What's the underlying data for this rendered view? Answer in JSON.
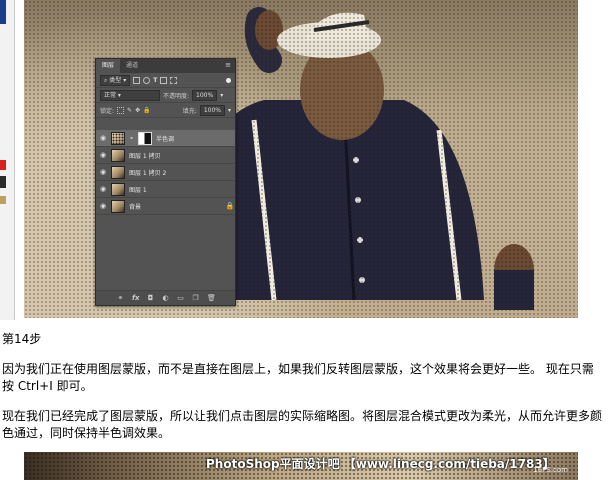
{
  "ps_panel": {
    "tab_layers": "图层",
    "tab_channels": "通道",
    "filter_kind": "类型",
    "blend_mode": "正常",
    "opacity_label": "不透明度:",
    "opacity_value": "100%",
    "lock_label": "锁定:",
    "fill_label": "填充:",
    "fill_value": "100%",
    "layers": [
      {
        "name": "半色调",
        "active": true,
        "has_mask": true
      },
      {
        "name": "图层 1 拷贝",
        "active": false,
        "has_mask": false
      },
      {
        "name": "图层 1 拷贝 2",
        "active": false,
        "has_mask": false
      },
      {
        "name": "图层 1",
        "active": false,
        "has_mask": false
      },
      {
        "name": "背景",
        "active": false,
        "has_mask": false,
        "locked": true
      }
    ],
    "bottom_icons": [
      "link-icon",
      "fx-icon",
      "add-mask-icon",
      "adjustment-icon",
      "folder-icon",
      "new-layer-icon",
      "trash-icon"
    ]
  },
  "article": {
    "step_title": "第14步",
    "para1_line1": "因为我们正在使用图层蒙版，而不是直接在图层上，如果我们反转图层蒙版，这个效果将会更好一些。 现在只需",
    "para1_line2": "按 Ctrl+I 即可。",
    "para2_line1": "现在我们已经完成了图层蒙版，所以让我们点击图层的实际缩略图。将图层混合模式更改为柔光，从而允许更多颜",
    "para2_line2": "色通过，同时保持半色调效果。"
  },
  "watermark": {
    "text": "PhotoShop平面设计吧 【www.linecg.com/tieba/1783】",
    "small_text": "16PS.com"
  },
  "colors": {
    "panel_bg": "#535353",
    "panel_tab_bg": "#3c3c3c",
    "active_layer": "#6b6b6b",
    "sepia": "#b8a889"
  }
}
